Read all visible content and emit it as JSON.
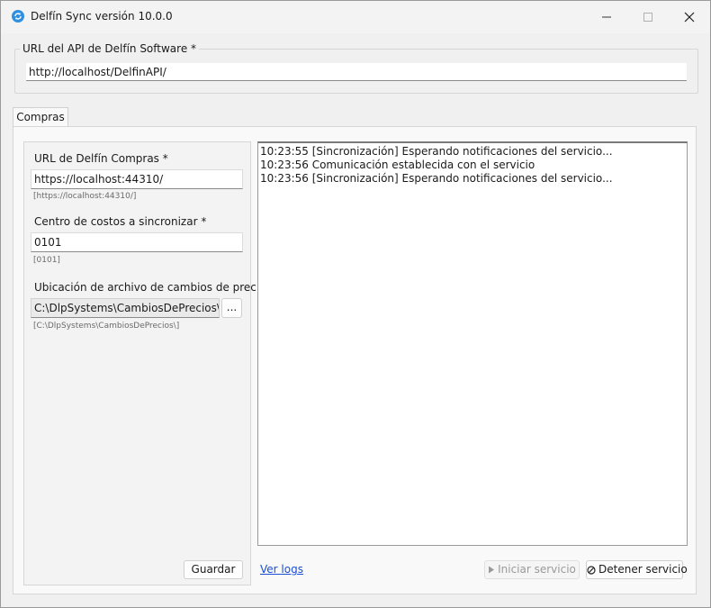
{
  "window": {
    "title": "Delfín Sync versión 10.0.0"
  },
  "api_group": {
    "legend": "URL del API de Delfín Software *",
    "value": "http://localhost/DelfinAPI/"
  },
  "tabs": [
    {
      "label": "Compras"
    }
  ],
  "settings": {
    "url_label": "URL de Delfín Compras *",
    "url_value": "https://localhost:44310/",
    "url_hint": "[https://localhost:44310/]",
    "cost_center_label": "Centro de costos a sincronizar *",
    "cost_center_value": "0101",
    "cost_center_hint": "[0101]",
    "file_label": "Ubicación de archivo de cambios de precio *",
    "file_value": "C:\\DlpSystems\\CambiosDePrecios\\",
    "file_hint": "[C:\\DlpSystems\\CambiosDePrecios\\]",
    "browse_label": "...",
    "save_label": "Guardar"
  },
  "log": {
    "lines": [
      "10:23:55 [Sincronización] Esperando notificaciones del servicio...",
      "10:23:56 Comunicación establecida con el servicio",
      "10:23:56 [Sincronización] Esperando notificaciones del servicio..."
    ]
  },
  "footer": {
    "view_logs_label": "Ver logs",
    "start_label": "Iniciar servicio",
    "stop_label": "Detener servicio"
  },
  "colors": {
    "accent": "#2f8fe0",
    "link": "#1a4fd6"
  }
}
